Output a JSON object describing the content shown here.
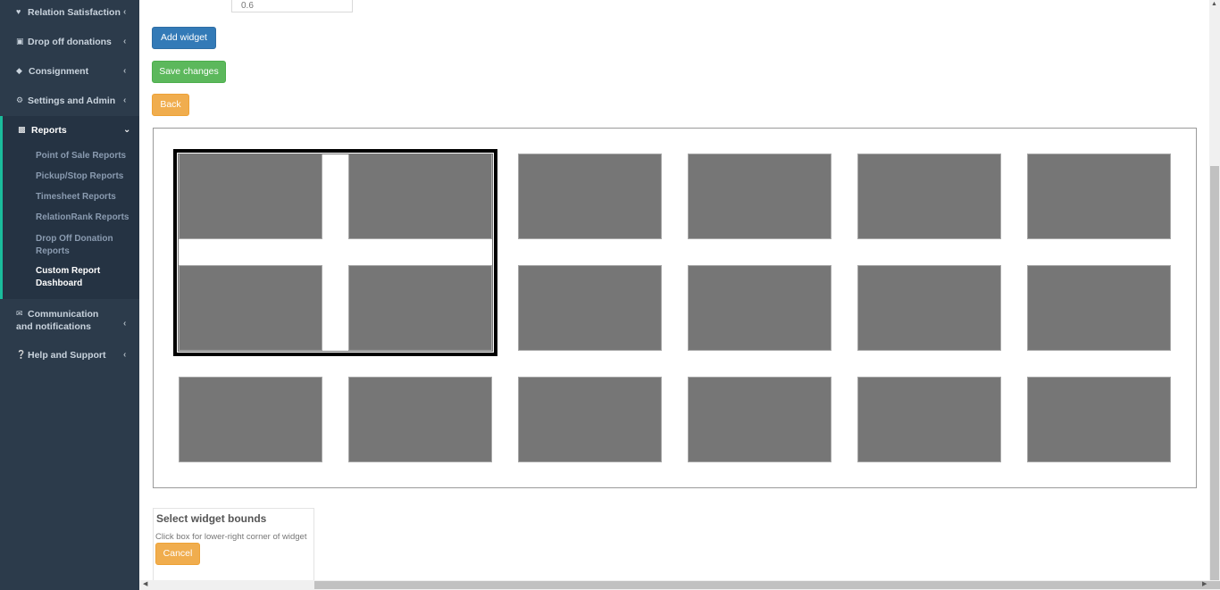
{
  "sidebar": {
    "items": [
      {
        "label": "Relation Satisfaction",
        "icon": "heart-icon"
      },
      {
        "label": "Drop off donations",
        "icon": "gift-icon"
      },
      {
        "label": "Consignment",
        "icon": "tag-icon"
      },
      {
        "label": "Settings and Admin",
        "icon": "gear-icon"
      },
      {
        "label": "Reports",
        "icon": "bar-chart-icon"
      },
      {
        "label": "Communication and notifications",
        "icon": "envelope-icon"
      },
      {
        "label": "Help and Support",
        "icon": "question-circle-icon"
      }
    ],
    "reports_sub": [
      "Point of Sale Reports",
      "Pickup/Stop Reports",
      "Timesheet Reports",
      "RelationRank Reports",
      "Drop Off Donation Reports",
      "Custom Report Dashboard"
    ],
    "active_sub": "Custom Report Dashboard",
    "accent_color": "#1abc9c"
  },
  "form": {
    "input_value": "0.6"
  },
  "buttons": {
    "add_widget": "Add widget",
    "save_changes": "Save changes",
    "back": "Back",
    "cancel": "Cancel"
  },
  "grid": {
    "rows": 3,
    "cols": 6,
    "selection": {
      "from_row": 1,
      "from_col": 1,
      "to_row": 2,
      "to_col": 2
    }
  },
  "bounds_panel": {
    "title": "Select widget bounds",
    "hint": "Click box for lower-right corner of widget"
  },
  "colors": {
    "primary": "#337ab7",
    "success": "#5cb85c",
    "warning": "#f0ad4e",
    "cell": "#767676",
    "sidebar_bg": "#2c3b4b"
  }
}
